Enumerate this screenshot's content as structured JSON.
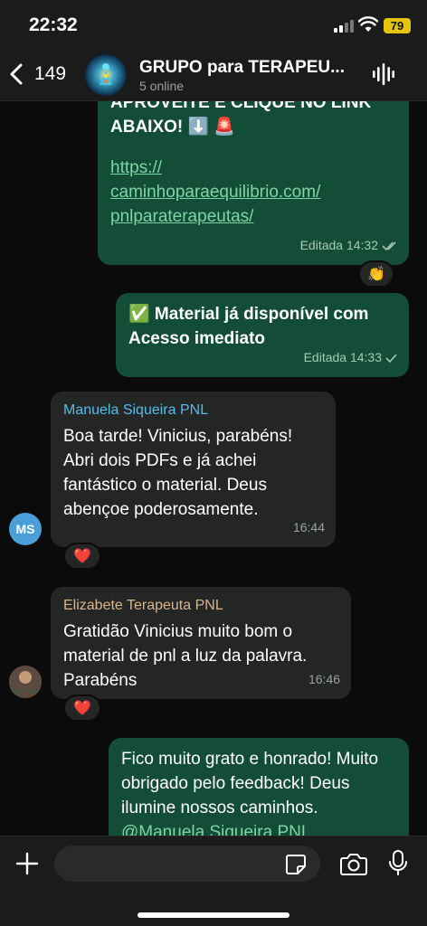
{
  "status_bar": {
    "time": "22:32",
    "battery": "79"
  },
  "header": {
    "back_count": "149",
    "title": "GRUPO para TERAPEU...",
    "subtitle": "5 online"
  },
  "messages": [
    {
      "type": "outgoing",
      "text_top": "APROVEITE E CLIQUE NO LINK",
      "text_line": "ABAIXO! ⬇️ 🚨",
      "link_lines": [
        "https://",
        "caminhoparaequilibrio.com/",
        "pnlparaterapeutas/"
      ],
      "meta": "Editada 14:32",
      "reaction": "👏"
    },
    {
      "type": "outgoing",
      "text": "✅ Material já disponível com Acesso imediato",
      "meta": "Editada 14:33"
    },
    {
      "type": "incoming",
      "sender": "Manuela Siqueira PNL",
      "sender_color": "#53bdeb",
      "avatar_initials": "MS",
      "text": "Boa tarde! Vinicius, parabéns! Abri dois PDFs e já achei fantástico o material. Deus abençoe poderosamente.",
      "time": "16:44",
      "reaction": "❤️"
    },
    {
      "type": "incoming",
      "sender": "Elizabete Terapeuta PNL",
      "sender_color": "#d9b58c",
      "text": "Gratidão Vinicius muito bom o material de pnl a luz da palavra. Parabéns",
      "time": "16:46",
      "reaction": "❤️"
    },
    {
      "type": "outgoing",
      "text": "Fico muito grato e honrado! Muito obrigado pelo feedback! Deus ilumine nossos caminhos.",
      "mention": "@Manuela Siqueira PNL"
    }
  ],
  "composer": {
    "placeholder": ""
  },
  "colors": {
    "outgoing_bubble": "#144d37",
    "incoming_bubble": "#242626",
    "link": "#7bd5a4",
    "background": "#0b0b0b"
  }
}
